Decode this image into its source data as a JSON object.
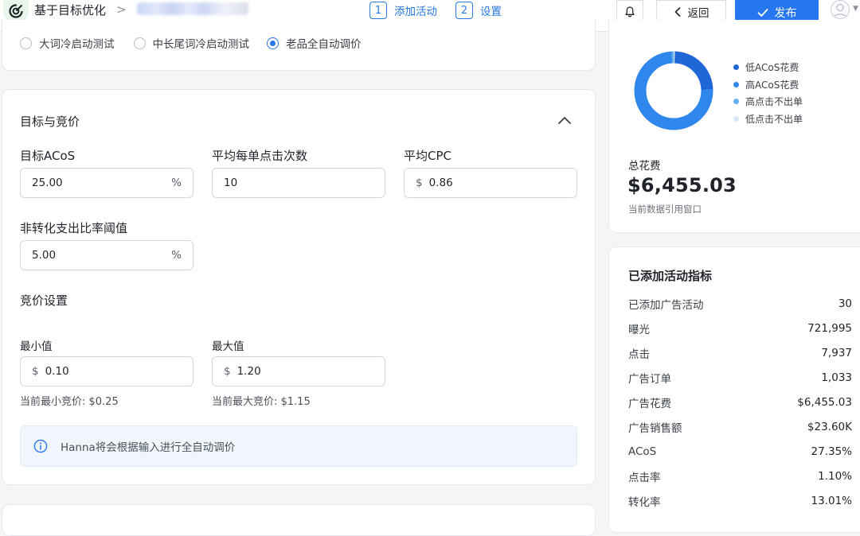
{
  "header": {
    "title": "基于目标优化",
    "breadcrumb_sep": ">",
    "steps": [
      {
        "num": "1",
        "label": "添加活动"
      },
      {
        "num": "2",
        "label": "设置"
      }
    ],
    "back_label": "返回",
    "publish_label": "发布"
  },
  "strategy": {
    "options": [
      {
        "label": "大词冷启动测试",
        "checked": false
      },
      {
        "label": "中长尾词冷启动测试",
        "checked": false
      },
      {
        "label": "老品全自动调价",
        "checked": true
      }
    ]
  },
  "goals": {
    "title": "目标与竞价",
    "target_acos": {
      "label": "目标ACoS",
      "value": "25.00",
      "suffix": "%"
    },
    "avg_clicks": {
      "label": "平均每单点击次数",
      "value": "10"
    },
    "avg_cpc": {
      "label": "平均CPC",
      "prefix": "$",
      "value": "0.86"
    },
    "non_conv_threshold": {
      "label": "非转化支出比率阈值",
      "value": "5.00",
      "suffix": "%"
    },
    "bid_settings": {
      "title": "竞价设置",
      "min": {
        "label": "最小值",
        "prefix": "$",
        "value": "0.10",
        "hint": "当前最小竞价: $0.25"
      },
      "max": {
        "label": "最大值",
        "prefix": "$",
        "value": "1.20",
        "hint": "当前最大竞价: $1.15"
      }
    },
    "info": "Hanna将会根据输入进行全自动调价"
  },
  "spend": {
    "legend": [
      {
        "label": "低ACoS花费",
        "color": "#1f66d6"
      },
      {
        "label": "高ACoS花费",
        "color": "#2f86ec"
      },
      {
        "label": "高点击不出单",
        "color": "#62aef0"
      },
      {
        "label": "低点击不出单",
        "color": "#d6e9fb"
      }
    ],
    "total_label": "总花费",
    "total_value": "$6,455.03",
    "total_sub": "当前数据引用窗口"
  },
  "metrics": {
    "title": "已添加活动指标",
    "rows": [
      {
        "label": "已添加广告活动",
        "value": "30"
      },
      {
        "label": "曝光",
        "value": "721,995"
      },
      {
        "label": "点击",
        "value": "7,937"
      },
      {
        "label": "广告订单",
        "value": "1,033"
      },
      {
        "label": "广告花费",
        "value": "$6,455.03"
      },
      {
        "label": "广告销售额",
        "value": "$23.60K"
      },
      {
        "label": "ACoS",
        "value": "27.35%"
      },
      {
        "label": "点击率",
        "value": "1.10%"
      },
      {
        "label": "转化率",
        "value": "13.01%"
      }
    ]
  }
}
